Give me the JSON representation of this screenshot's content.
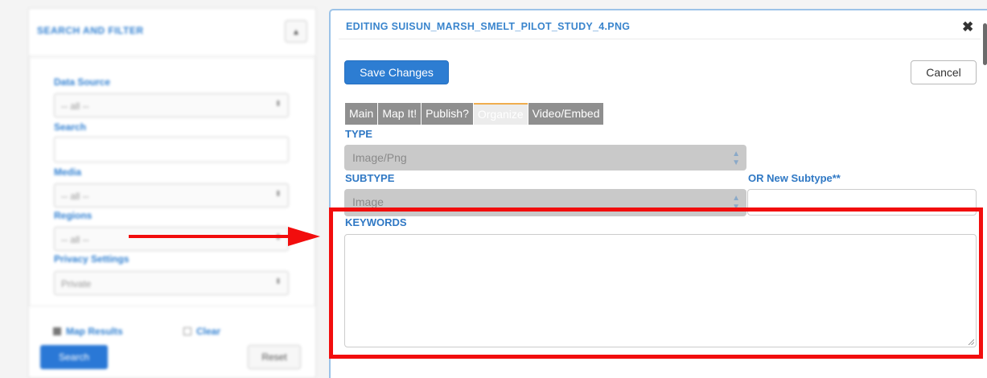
{
  "sidebar": {
    "title": "SEARCH AND FILTER",
    "toggle_icon": "chevron-up-icon",
    "fields": [
      {
        "label": "Data Source",
        "value": "-- all --",
        "kind": "select"
      },
      {
        "label": "Search",
        "value": "",
        "kind": "input"
      },
      {
        "label": "Media",
        "value": "-- all --",
        "kind": "select"
      },
      {
        "label": "Regions",
        "value": "-- all --",
        "kind": "select"
      },
      {
        "label": "Privacy Settings",
        "value": "Private",
        "kind": "select"
      }
    ],
    "map_results_label": "Map Results",
    "clear_label": "Clear",
    "search_button": "Search",
    "reset_button": "Reset"
  },
  "modal": {
    "title": "EDITING SUISUN_MARSH_SMELT_PILOT_STUDY_4.PNG",
    "close_symbol": "✖",
    "save_label": "Save Changes",
    "cancel_label": "Cancel",
    "tabs": [
      {
        "label": "Main",
        "active": false
      },
      {
        "label": "Map It!",
        "active": false
      },
      {
        "label": "Publish?",
        "active": false
      },
      {
        "label": "Organize",
        "active": true
      },
      {
        "label": "Video/Embed",
        "active": false
      }
    ],
    "type": {
      "label": "TYPE",
      "value": "Image/Png"
    },
    "subtype": {
      "label": "SUBTYPE",
      "value": "Image"
    },
    "new_subtype": {
      "label": "OR New Subtype**",
      "value": ""
    },
    "keywords": {
      "label": "KEYWORDS",
      "value": ""
    }
  },
  "colors": {
    "accent_blue": "#2d7dd2",
    "label_blue": "#2f78c4",
    "highlight_red": "#f20d0d",
    "active_tab_border": "#f0ad4e"
  }
}
